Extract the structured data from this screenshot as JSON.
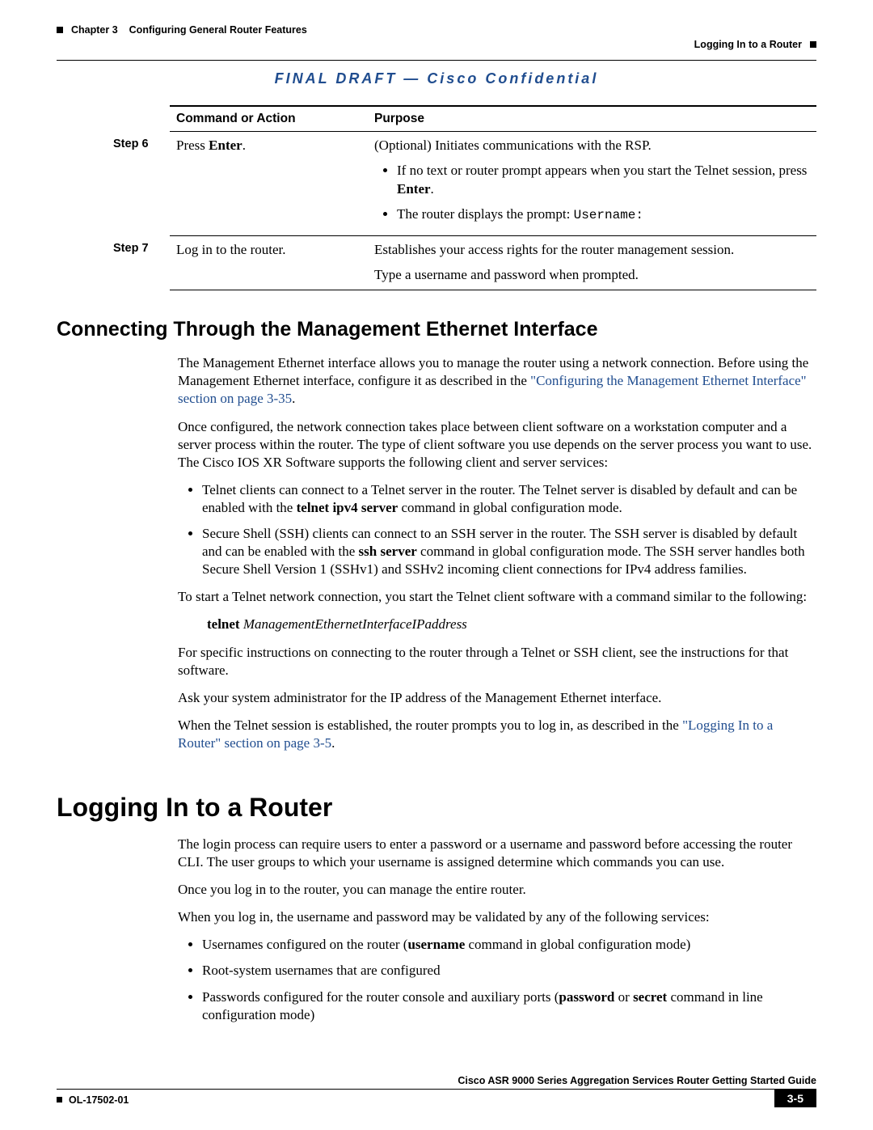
{
  "header": {
    "chapter_label": "Chapter 3",
    "chapter_title": "Configuring General Router Features",
    "section_title": "Logging In to a Router",
    "draft_banner": "FINAL DRAFT — Cisco Confidential"
  },
  "table": {
    "headers": {
      "col2": "Command or Action",
      "col3": "Purpose"
    },
    "row1": {
      "step": "Step 6",
      "action_pre": "Press ",
      "action_bold": "Enter",
      "action_post": ".",
      "purpose_lead": "(Optional) Initiates communications with the RSP.",
      "b1_pre": "If no text or router prompt appears when you start the Telnet session, press ",
      "b1_bold": "Enter",
      "b1_post": ".",
      "b2_pre": "The router displays the prompt: ",
      "b2_code": "Username:"
    },
    "row2": {
      "step": "Step 7",
      "action": "Log in to the router.",
      "purpose_l1": "Establishes your access rights for the router management session.",
      "purpose_l2": "Type a username and password when prompted."
    }
  },
  "sec1": {
    "title": "Connecting Through the Management Ethernet Interface",
    "p1_pre": "The Management Ethernet interface allows you to manage the router using a network connection. Before using the Management Ethernet interface, configure it as described in the ",
    "p1_link": "\"Configuring the Management Ethernet Interface\" section on page 3-35",
    "p1_post": ".",
    "p2": "Once configured, the network connection takes place between client software on a workstation computer and a server process within the router. The type of client software you use depends on the server process you want to use. The Cisco IOS XR Software supports the following client and server services:",
    "b1_pre": "Telnet clients can connect to a Telnet server in the router. The Telnet server is disabled by default and can be enabled with the ",
    "b1_bold": "telnet ipv4 server",
    "b1_post": " command in global configuration mode.",
    "b2_pre": "Secure Shell (SSH) clients can connect to an SSH server in the router. The SSH server is disabled by default and can be enabled with the ",
    "b2_bold": "ssh server",
    "b2_post": " command in global configuration mode. The SSH server handles both Secure Shell Version 1 (SSHv1) and SSHv2 incoming client connections for IPv4 address families.",
    "p3": "To start a Telnet network connection, you start the Telnet client software with a command similar to the following:",
    "cmd_bold": "telnet",
    "cmd_ital": " ManagementEthernetInterfaceIPaddress",
    "p4": "For specific instructions on connecting to the router through a Telnet or SSH client, see the instructions for that software.",
    "p5": "Ask your system administrator for the IP address of the Management Ethernet interface.",
    "p6_pre": "When the Telnet session is established, the router prompts you to log in, as described in the ",
    "p6_link": "\"Logging In to a Router\" section on page 3-5",
    "p6_post": "."
  },
  "sec2": {
    "title": "Logging In to a Router",
    "p1": "The login process can require users to enter a password or a username and password before accessing the router CLI. The user groups to which your username is assigned determine which commands you can use.",
    "p2": "Once you log in to the router, you can manage the entire router.",
    "p3": "When you log in, the username and password may be validated by any of the following services:",
    "b1_pre": "Usernames configured on the router (",
    "b1_bold": "username",
    "b1_post": " command in global configuration mode)",
    "b2": "Root-system usernames that are configured",
    "b3_pre": "Passwords configured for the router console and auxiliary ports (",
    "b3_bold1": "password",
    "b3_mid": " or ",
    "b3_bold2": "secret",
    "b3_post": " command in line configuration mode)"
  },
  "footer": {
    "guide": "Cisco ASR 9000 Series Aggregation Services Router Getting Started Guide",
    "ol": "OL-17502-01",
    "page": "3-5"
  }
}
